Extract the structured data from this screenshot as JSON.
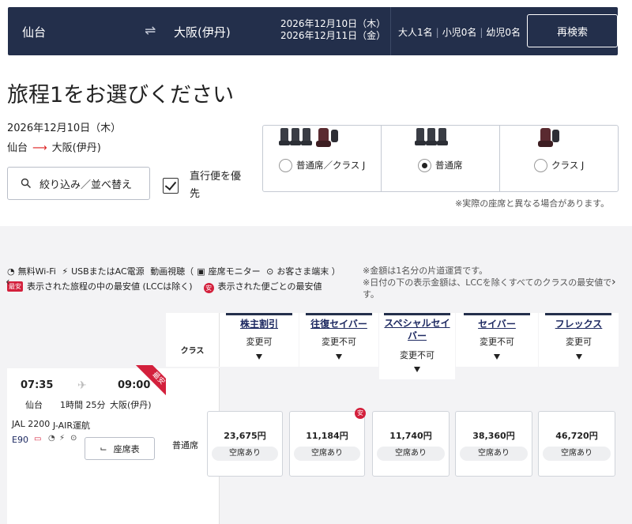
{
  "header": {
    "departure": "仙台",
    "arrival": "大阪(伊丹)",
    "date_out": "2026年12月10日（木）",
    "date_return": "2026年12月11日（金）",
    "adults": "大人1名",
    "children": "小児0名",
    "infants": "幼児0名",
    "research_label": "再検索"
  },
  "page": {
    "title": "旅程1をお選びください",
    "selected_date": "2026年12月10日（木）",
    "route_from": "仙台",
    "route_to": "大阪(伊丹)",
    "filter_label": "絞り込み／並べ替え",
    "nonstop_label": "直行便を優先"
  },
  "seat_options": [
    {
      "label": "普通席／クラス J",
      "selected": false
    },
    {
      "label": "普通席",
      "selected": true
    },
    {
      "label": "クラス J",
      "selected": false
    }
  ],
  "seat_note": "※実際の座席と異なる場合があります。",
  "amenities": {
    "wifi": "無料Wi-Fi",
    "power": "USBまたはAC電源",
    "video": "動画視聴（",
    "monitor": "座席モニター",
    "device": "お客さま端末 ）"
  },
  "legend": {
    "lowest_tag": "最安",
    "lowest_trip": "表示された旅程の中の最安値 (LCCは除く)",
    "cheap_icon": "安",
    "lowest_flight": "表示された便ごとの最安値"
  },
  "notes": {
    "line1": "※金額は1名分の片道運賃です。",
    "line2": "※日付の下の表示金額は、LCCを除くすべてのクラスの最安値です。"
  },
  "table": {
    "class_header": "クラス",
    "fares": [
      {
        "name": "株主割引",
        "change": "変更可"
      },
      {
        "name": "往復セイバー",
        "change": "変更不可"
      },
      {
        "name": "スペシャルセイバー",
        "change": "変更不可"
      },
      {
        "name": "セイバー",
        "change": "変更不可"
      },
      {
        "name": "フレックス",
        "change": "変更可"
      }
    ]
  },
  "flight": {
    "dep_time": "07:35",
    "arr_time": "09:00",
    "dep_airport": "仙台",
    "duration": "1時間 25分",
    "arr_airport": "大阪(伊丹)",
    "flight_no": "JAL 2200",
    "operator": "J-AIR運航",
    "aircraft": "E90",
    "badge": "最安",
    "seatmap_label": "座席表",
    "class": "普通席",
    "prices": [
      {
        "price": "23,675円",
        "avail": "空席あり",
        "cheapest": false
      },
      {
        "price": "11,184円",
        "avail": "空席あり",
        "cheapest": true
      },
      {
        "price": "11,740円",
        "avail": "空席あり",
        "cheapest": false
      },
      {
        "price": "38,360円",
        "avail": "空席あり",
        "cheapest": false
      },
      {
        "price": "46,720円",
        "avail": "空席あり",
        "cheapest": false
      }
    ]
  },
  "colors": {
    "navy": "#232f4b",
    "accent_red": "#d3203c",
    "link_blue": "#1e2a62"
  }
}
